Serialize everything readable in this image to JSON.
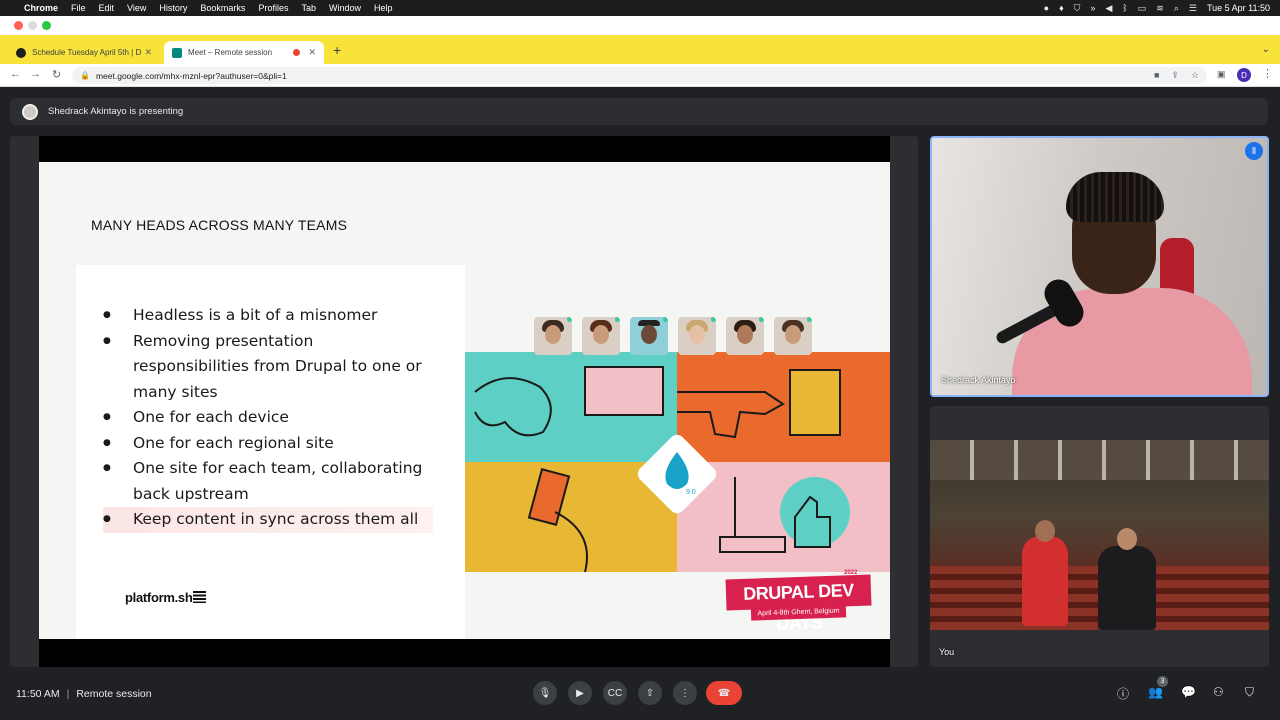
{
  "mac_menubar": {
    "app_name": "Chrome",
    "menus": [
      "File",
      "Edit",
      "View",
      "History",
      "Bookmarks",
      "Profiles",
      "Tab",
      "Window",
      "Help"
    ],
    "clock": "Tue 5 Apr  11:50"
  },
  "browser": {
    "tabs": [
      {
        "label": "Schedule Tuesday April 5th | D",
        "active": false
      },
      {
        "label": "Meet – Remote session",
        "active": true
      }
    ],
    "new_tab_label": "+",
    "url": "meet.google.com/mhx-mznl-epr?authuser=0&pli=1",
    "profile_initial": "D"
  },
  "meet": {
    "presenting_banner": "Shedrack Akintayo is presenting",
    "presenter_name": "Shedrack Akintayo",
    "self_label": "You",
    "time": "11:50 AM",
    "separator": "|",
    "meeting_name": "Remote session",
    "participant_count": "3"
  },
  "slide": {
    "title": "MANY HEADS ACROSS MANY TEAMS",
    "bullets": [
      "Headless is a bit of a misnomer",
      "Removing presentation responsibilities from Drupal to one or many sites",
      "One for each device",
      "One for each regional site",
      "One site for each team, collaborating back upstream",
      "Keep content in sync across them all"
    ],
    "logo_text": "platform.sh",
    "drupal_version": "9.0",
    "badge_main": "DRUPAL DEV DAYS",
    "badge_sub": "April 4-8th Ghent, Belgium",
    "badge_year": "2022"
  },
  "colors": {
    "chrome_tabbar": "#f7e33a",
    "meet_bg": "#202124",
    "end_call": "#ea4335",
    "tile_highlight": "#8ab4f8",
    "teal": "#5ecfc4",
    "orange": "#e96a2c",
    "mustard": "#e8b733",
    "pink": "#f3bfc7",
    "drupal_red": "#d8214f"
  }
}
